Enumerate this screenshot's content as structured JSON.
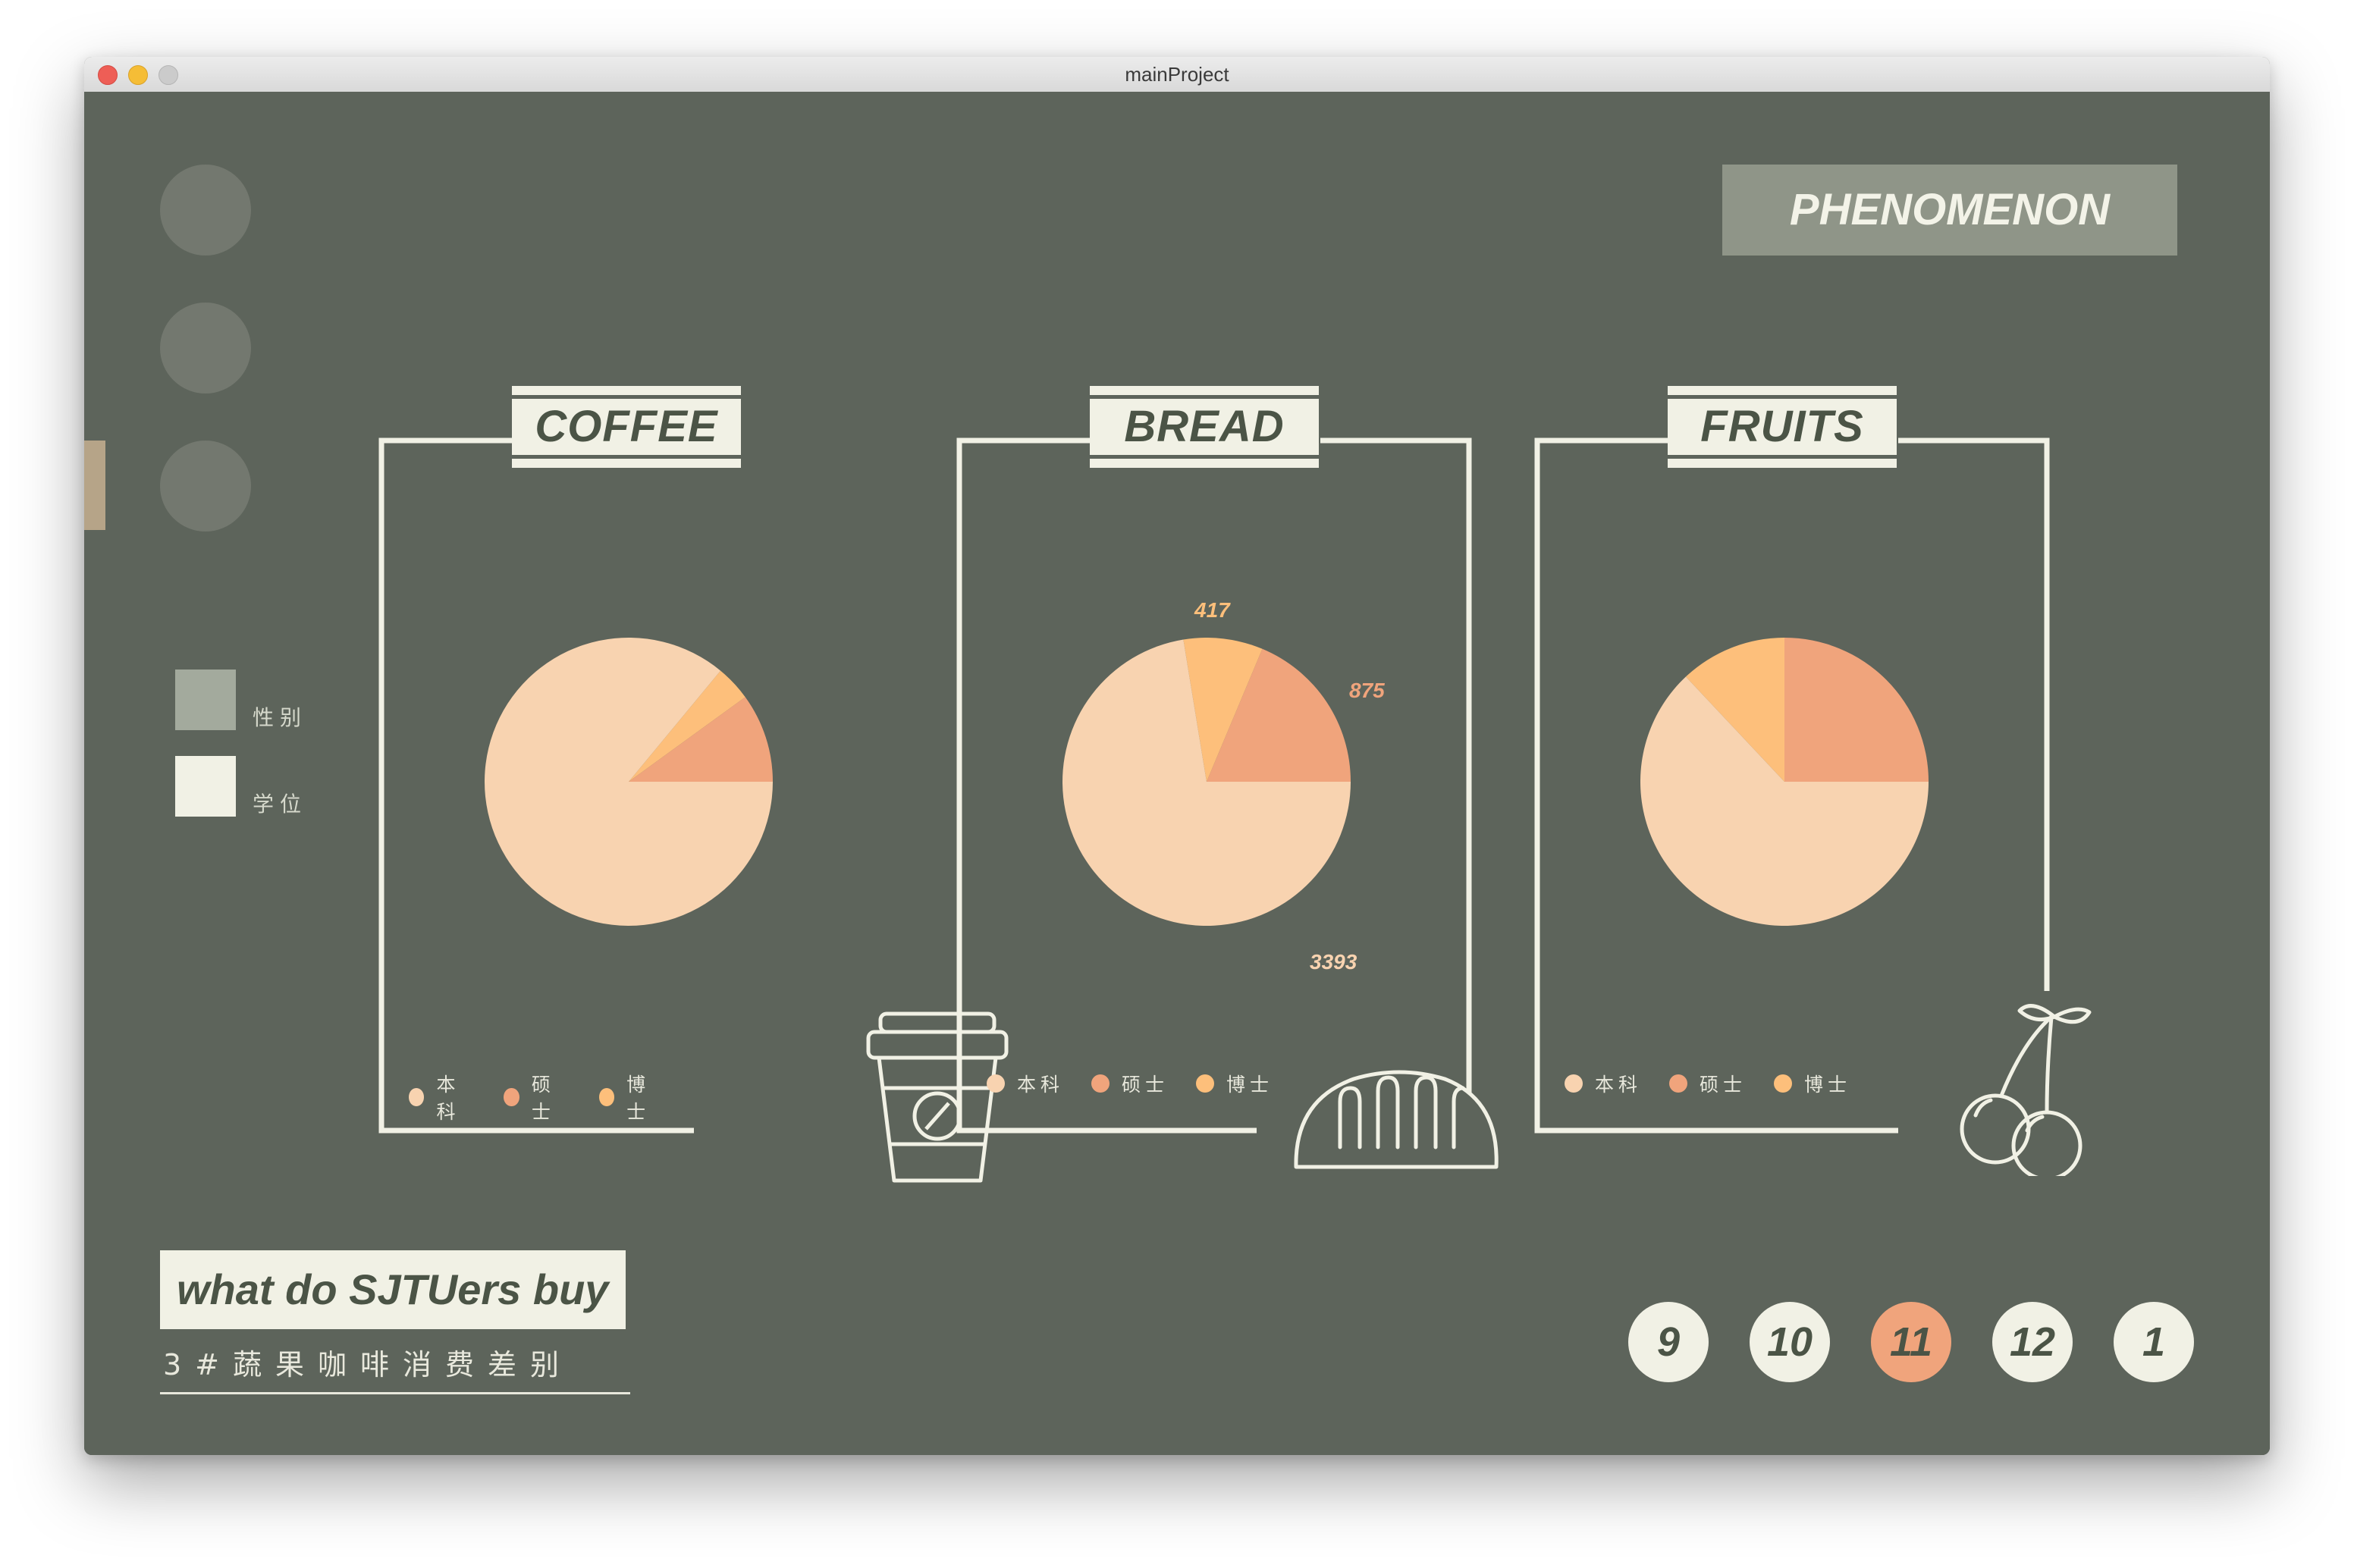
{
  "window": {
    "title": "mainProject"
  },
  "header": {
    "phenomenon_label": "PHENOMENON"
  },
  "sidebar": {
    "nav_count": 3,
    "legend": [
      {
        "label": "性别",
        "color": "#a3aa9d"
      },
      {
        "label": "学位",
        "color": "#f1f1e5"
      }
    ]
  },
  "colors": {
    "background": "#5d645b",
    "cream": "#f1f1e5",
    "undergrad": "#f8d3b0",
    "master": "#f0a47c",
    "phd": "#fdbf7b"
  },
  "panels": [
    {
      "title": "COFFEE",
      "icon": "coffee-cup-icon",
      "legend": [
        "本科",
        "硕士",
        "博士"
      ],
      "chart_data": {
        "type": "pie",
        "labels": [
          "本科",
          "硕士",
          "博士"
        ],
        "values": [
          86,
          10,
          4
        ],
        "data_labels": []
      }
    },
    {
      "title": "BREAD",
      "icon": "bread-icon",
      "legend": [
        "本科",
        "硕士",
        "博士"
      ],
      "chart_data": {
        "type": "pie",
        "labels": [
          "本科",
          "硕士",
          "博士"
        ],
        "values": [
          3393,
          875,
          417
        ],
        "data_labels": [
          "3393",
          "875",
          "417"
        ]
      }
    },
    {
      "title": "FRUITS",
      "icon": "cherry-icon",
      "legend": [
        "本科",
        "硕士",
        "博士"
      ],
      "chart_data": {
        "type": "pie",
        "labels": [
          "本科",
          "硕士",
          "博士"
        ],
        "values": [
          63,
          25,
          12
        ],
        "data_labels": []
      }
    }
  ],
  "footer": {
    "title": "what do SJTUers buy",
    "subtitle": "3#蔬果咖啡消费差别",
    "months": [
      "9",
      "10",
      "11",
      "12",
      "1"
    ],
    "active_month": "11"
  }
}
